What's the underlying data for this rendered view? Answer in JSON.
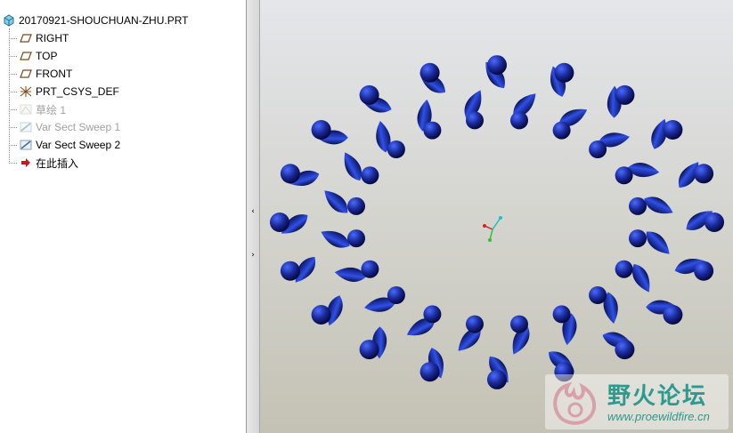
{
  "model_tree": {
    "root": {
      "label": "20170921-SHOUCHUAN-ZHU.PRT",
      "icon": "part-icon"
    },
    "items": [
      {
        "label": "RIGHT",
        "icon": "datum-plane-icon",
        "state": "normal"
      },
      {
        "label": "TOP",
        "icon": "datum-plane-icon",
        "state": "normal"
      },
      {
        "label": "FRONT",
        "icon": "datum-plane-icon",
        "state": "normal"
      },
      {
        "label": "PRT_CSYS_DEF",
        "icon": "csys-icon",
        "state": "normal"
      },
      {
        "label": "草绘 1",
        "icon": "sketch-icon",
        "state": "suppressed"
      },
      {
        "label": "Var Sect Sweep 1",
        "icon": "sweep-icon",
        "state": "suppressed"
      },
      {
        "label": "Var Sect Sweep 2",
        "icon": "sweep-icon",
        "state": "normal"
      },
      {
        "label": "在此插入",
        "icon": "insert-here-arrow-icon",
        "state": "normal"
      }
    ]
  },
  "splitter": {
    "collapse": "‹",
    "expand": "›"
  },
  "viewport": {
    "model_color": "#1a2a9a",
    "csys_colors": [
      "#d82020",
      "#20c0c0",
      "#30c030"
    ]
  },
  "watermark": {
    "title": "野火论坛",
    "url": "www.proewildfire.cn",
    "color": "#2c9a8e"
  }
}
